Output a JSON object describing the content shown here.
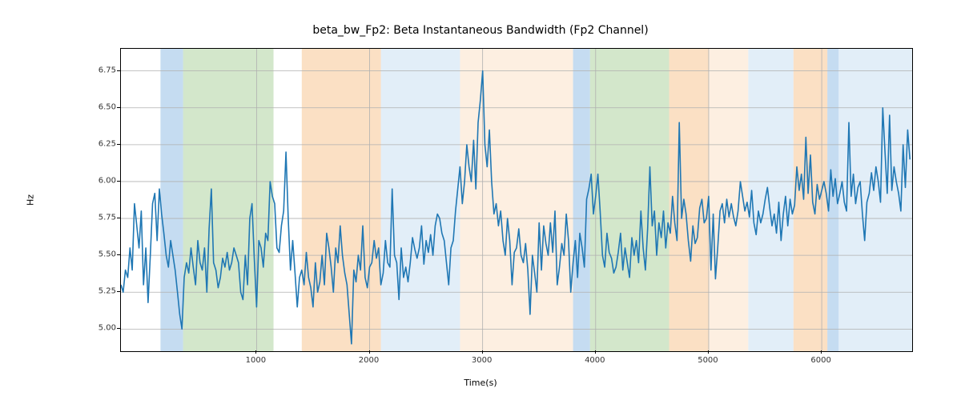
{
  "title": "beta_bw_Fp2: Beta Instantaneous Bandwidth (Fp2 Channel)",
  "xlabel": "Time(s)",
  "ylabel": "Hz",
  "chart_data": {
    "type": "line",
    "xlim": [
      -200,
      6800
    ],
    "ylim": [
      4.85,
      6.9
    ],
    "xticks": [
      1000,
      2000,
      3000,
      4000,
      5000,
      6000
    ],
    "yticks": [
      5.0,
      5.25,
      5.5,
      5.75,
      6.0,
      6.25,
      6.5,
      6.75
    ],
    "spans": [
      {
        "x0": 150,
        "x1": 350,
        "color": "#9fc5e8"
      },
      {
        "x0": 350,
        "x1": 1150,
        "color": "#b6d7a8"
      },
      {
        "x0": 1400,
        "x1": 2100,
        "color": "#f9cb9c"
      },
      {
        "x0": 2100,
        "x1": 2800,
        "color": "#cfe2f3"
      },
      {
        "x0": 2800,
        "x1": 3800,
        "color": "#fce5cd"
      },
      {
        "x0": 3800,
        "x1": 3950,
        "color": "#9fc5e8"
      },
      {
        "x0": 3950,
        "x1": 4650,
        "color": "#b6d7a8"
      },
      {
        "x0": 4650,
        "x1": 5000,
        "color": "#f9cb9c"
      },
      {
        "x0": 5000,
        "x1": 5350,
        "color": "#fce5cd"
      },
      {
        "x0": 5350,
        "x1": 5750,
        "color": "#cfe2f3"
      },
      {
        "x0": 5750,
        "x1": 6050,
        "color": "#f9cb9c"
      },
      {
        "x0": 6050,
        "x1": 6150,
        "color": "#9fc5e8"
      },
      {
        "x0": 6150,
        "x1": 6800,
        "color": "#cfe2f3"
      }
    ],
    "series": [
      {
        "name": "beta_bw_Fp2",
        "x_step": 20,
        "x_start": -200,
        "values": [
          5.3,
          5.25,
          5.4,
          5.35,
          5.55,
          5.4,
          5.85,
          5.7,
          5.55,
          5.8,
          5.3,
          5.55,
          5.18,
          5.5,
          5.85,
          5.92,
          5.6,
          5.95,
          5.78,
          5.65,
          5.5,
          5.42,
          5.6,
          5.5,
          5.4,
          5.25,
          5.1,
          5.0,
          5.35,
          5.45,
          5.38,
          5.55,
          5.42,
          5.3,
          5.6,
          5.45,
          5.4,
          5.55,
          5.25,
          5.68,
          5.95,
          5.45,
          5.4,
          5.28,
          5.35,
          5.48,
          5.42,
          5.52,
          5.4,
          5.45,
          5.55,
          5.5,
          5.45,
          5.25,
          5.2,
          5.5,
          5.3,
          5.75,
          5.85,
          5.48,
          5.15,
          5.6,
          5.55,
          5.42,
          5.65,
          5.6,
          6.0,
          5.9,
          5.85,
          5.55,
          5.52,
          5.7,
          5.8,
          6.2,
          5.75,
          5.4,
          5.6,
          5.38,
          5.15,
          5.35,
          5.4,
          5.3,
          5.52,
          5.35,
          5.28,
          5.15,
          5.45,
          5.25,
          5.32,
          5.5,
          5.3,
          5.65,
          5.55,
          5.42,
          5.25,
          5.55,
          5.45,
          5.7,
          5.5,
          5.38,
          5.3,
          5.1,
          4.9,
          5.4,
          5.32,
          5.5,
          5.4,
          5.7,
          5.35,
          5.28,
          5.42,
          5.45,
          5.6,
          5.48,
          5.55,
          5.3,
          5.38,
          5.6,
          5.45,
          5.42,
          5.95,
          5.5,
          5.45,
          5.2,
          5.55,
          5.35,
          5.42,
          5.32,
          5.45,
          5.62,
          5.54,
          5.48,
          5.55,
          5.7,
          5.44,
          5.6,
          5.52,
          5.64,
          5.5,
          5.7,
          5.78,
          5.75,
          5.65,
          5.6,
          5.45,
          5.3,
          5.55,
          5.6,
          5.8,
          5.95,
          6.1,
          5.85,
          6.0,
          6.25,
          6.1,
          6.0,
          6.28,
          5.95,
          6.4,
          6.55,
          6.75,
          6.25,
          6.1,
          6.35,
          6.0,
          5.78,
          5.85,
          5.7,
          5.8,
          5.6,
          5.5,
          5.75,
          5.6,
          5.3,
          5.52,
          5.55,
          5.68,
          5.5,
          5.45,
          5.58,
          5.4,
          5.1,
          5.5,
          5.38,
          5.25,
          5.72,
          5.4,
          5.7,
          5.58,
          5.5,
          5.72,
          5.52,
          5.8,
          5.3,
          5.42,
          5.58,
          5.5,
          5.78,
          5.6,
          5.25,
          5.45,
          5.6,
          5.35,
          5.65,
          5.55,
          5.42,
          5.88,
          5.95,
          6.05,
          5.78,
          5.9,
          6.05,
          5.8,
          5.5,
          5.42,
          5.65,
          5.52,
          5.48,
          5.38,
          5.42,
          5.52,
          5.65,
          5.4,
          5.55,
          5.45,
          5.35,
          5.62,
          5.5,
          5.6,
          5.45,
          5.8,
          5.55,
          5.4,
          5.68,
          6.1,
          5.7,
          5.8,
          5.5,
          5.72,
          5.62,
          5.8,
          5.55,
          5.72,
          5.65,
          5.9,
          5.72,
          5.6,
          6.4,
          5.75,
          5.88,
          5.78,
          5.6,
          5.46,
          5.7,
          5.58,
          5.62,
          5.82,
          5.88,
          5.72,
          5.75,
          5.9,
          5.4,
          5.78,
          5.34,
          5.55,
          5.8,
          5.85,
          5.72,
          5.88,
          5.76,
          5.85,
          5.76,
          5.7,
          5.8,
          6.0,
          5.9,
          5.8,
          5.86,
          5.76,
          5.94,
          5.72,
          5.64,
          5.8,
          5.72,
          5.78,
          5.88,
          5.96,
          5.82,
          5.7,
          5.78,
          5.65,
          5.86,
          5.6,
          5.78,
          5.9,
          5.7,
          5.88,
          5.78,
          5.84,
          6.1,
          5.94,
          6.05,
          5.88,
          6.3,
          5.92,
          6.18,
          5.86,
          5.78,
          5.98,
          5.88,
          5.94,
          6.0,
          5.92,
          5.8,
          6.08,
          5.9,
          6.02,
          5.85,
          5.92,
          6.0,
          5.86,
          5.8,
          6.4,
          5.9,
          6.05,
          5.85,
          5.96,
          6.0,
          5.78,
          5.6,
          5.86,
          5.92,
          6.06,
          5.94,
          6.1,
          6.0,
          5.86,
          6.5,
          6.2,
          5.92,
          6.45,
          5.94,
          6.1,
          6.0,
          5.92,
          5.8,
          6.25,
          5.96,
          6.35,
          6.15
        ]
      }
    ]
  }
}
